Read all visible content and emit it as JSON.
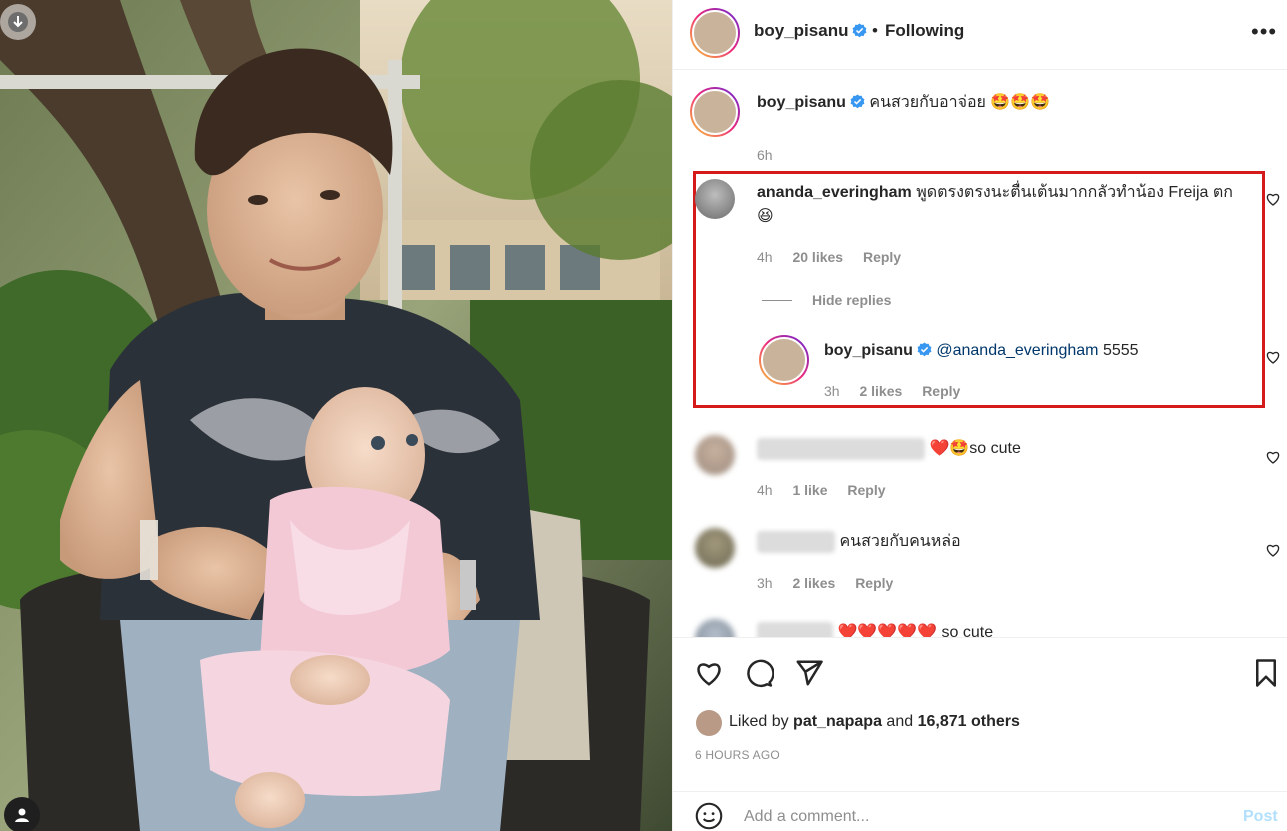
{
  "post": {
    "author": "boy_pisanu",
    "follow_status": "Following",
    "separator": "•",
    "more_label": "•••"
  },
  "caption": {
    "username": "boy_pisanu",
    "text": "คนสวยกับอาจ่อย",
    "emojis": "🤩🤩🤩",
    "time": "6h"
  },
  "comments": [
    {
      "username": "ananda_everingham",
      "text": "พูดตรงตรงนะตื่นเต้นมากกลัวทำน้อง Freija ตก",
      "emoji": "😆",
      "time": "4h",
      "likes": "20 likes",
      "reply_label": "Reply",
      "hide_replies": "Hide replies",
      "reply": {
        "username": "boy_pisanu",
        "mention": "@ananda_everingham",
        "text": "5555",
        "time": "3h",
        "likes": "2 likes",
        "reply_label": "Reply"
      }
    },
    {
      "text": "so cute",
      "emoji": "❤️🤩",
      "time": "4h",
      "likes": "1 like",
      "reply_label": "Reply"
    },
    {
      "text": "คนสวยกับคนหล่อ",
      "time": "3h",
      "likes": "2 likes",
      "reply_label": "Reply"
    },
    {
      "text": "so cute",
      "emoji": "❤️❤️❤️❤️❤️"
    }
  ],
  "likes": {
    "prefix": "Liked by",
    "user": "pat_napapa",
    "and": "and",
    "count": "16,871 others"
  },
  "timestamp": "6 HOURS AGO",
  "composer": {
    "placeholder": "Add a comment...",
    "post_label": "Post"
  },
  "colors": {
    "highlight_box": "#d51a1a",
    "verified": "#3897f0",
    "post_disabled": "#b2dffc"
  }
}
